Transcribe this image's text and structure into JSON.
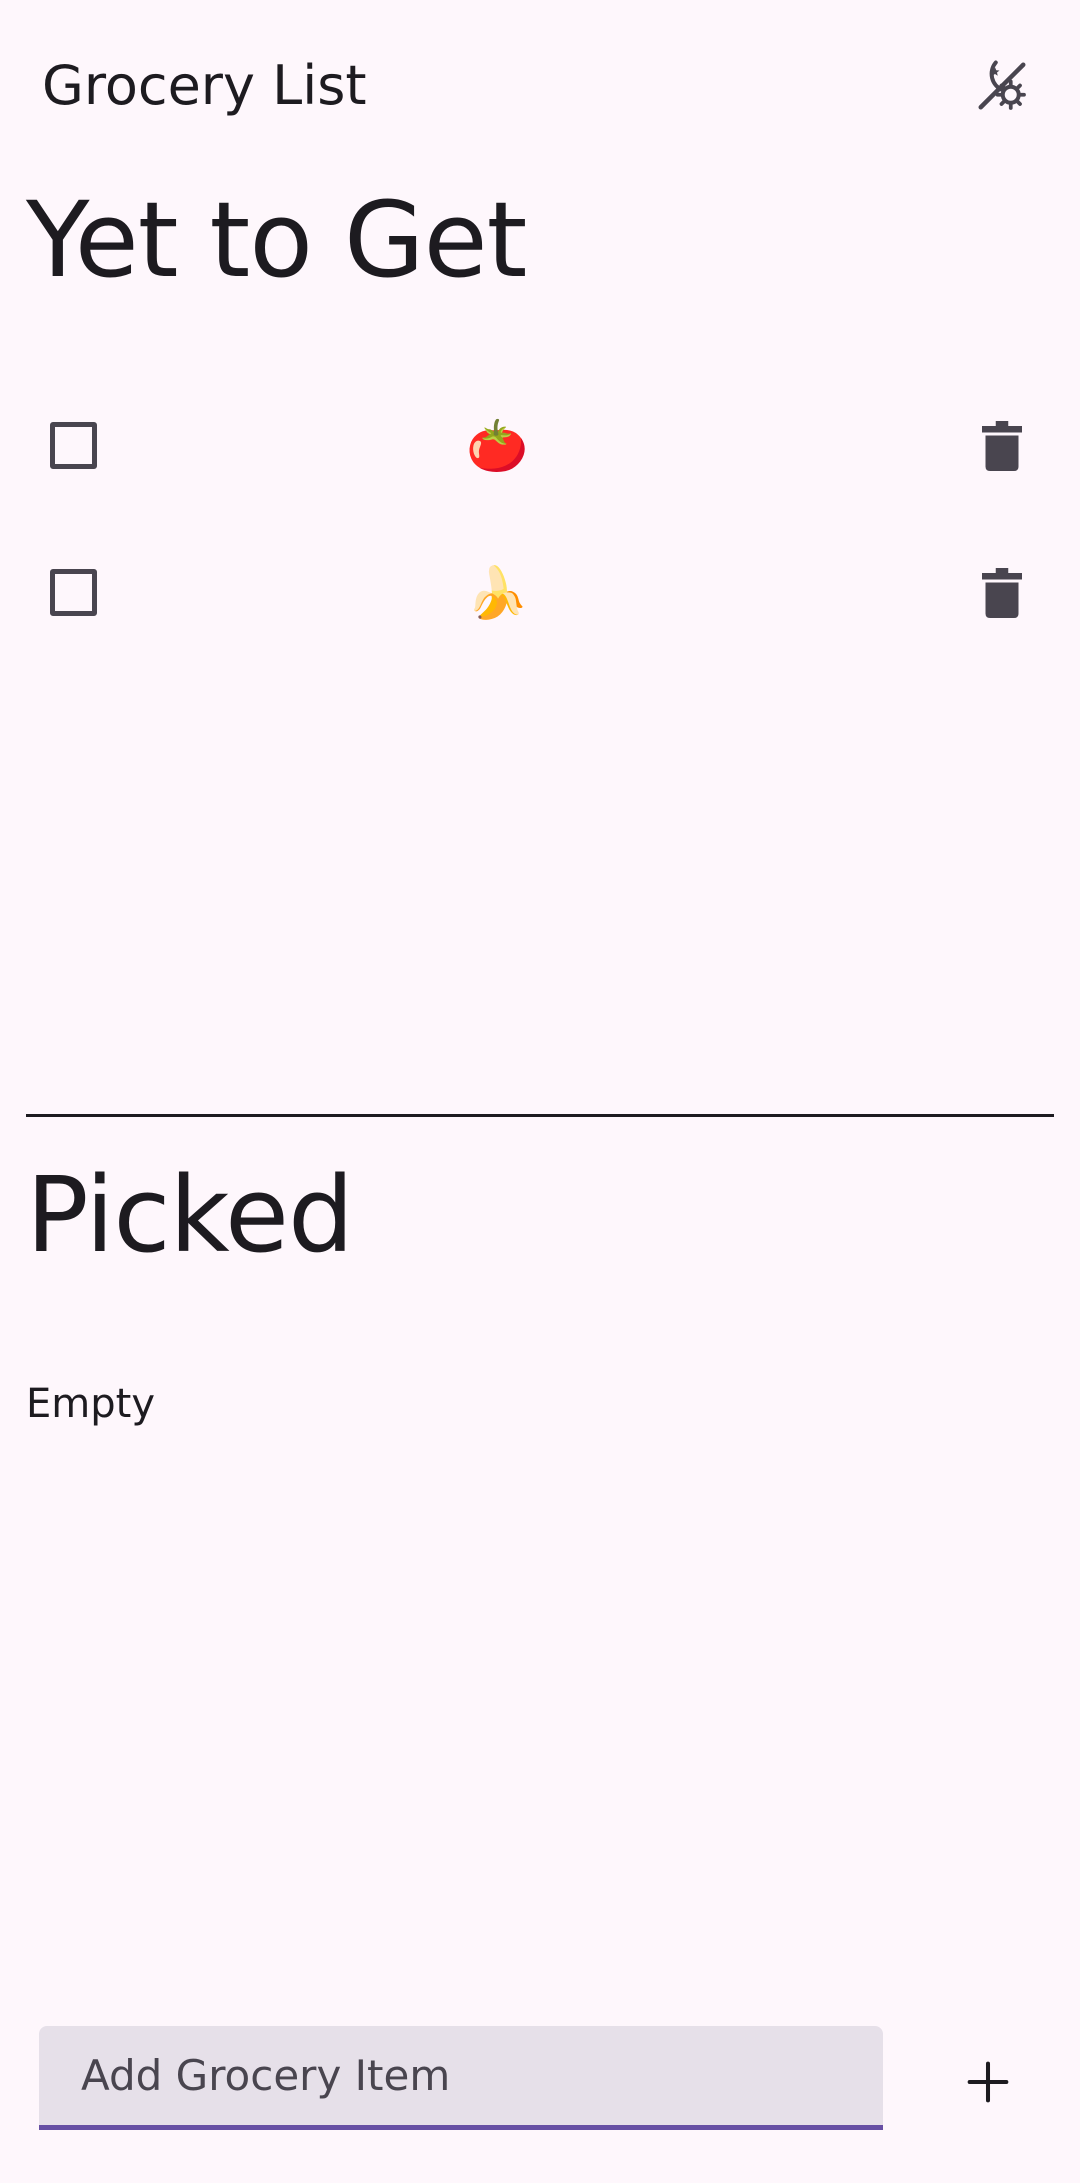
{
  "app_bar": {
    "title": "Grocery List",
    "theme_toggle_icon": "dark-light-mode-icon"
  },
  "sections": {
    "yet_to_get": {
      "title": "Yet to Get",
      "items": [
        {
          "emoji": "🍅",
          "checked": false,
          "delete_icon": "trash-icon"
        },
        {
          "emoji": "🍌",
          "checked": false,
          "delete_icon": "trash-icon"
        }
      ]
    },
    "picked": {
      "title": "Picked",
      "empty_text": "Empty"
    }
  },
  "add_item": {
    "placeholder": "Add Grocery Item",
    "value": "",
    "add_icon": "plus-icon"
  },
  "colors": {
    "background": "#fef7fc",
    "text": "#1d1b20",
    "icon": "#49454f",
    "field_background": "#e6e0e9",
    "accent": "#6750a4"
  }
}
